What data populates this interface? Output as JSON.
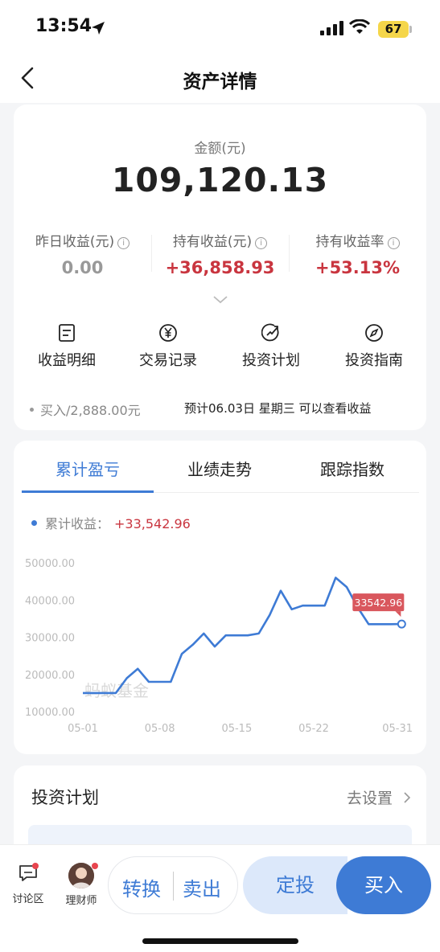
{
  "status_bar": {
    "time": "13:54",
    "battery": "67"
  },
  "nav": {
    "title": "资产详情"
  },
  "asset": {
    "amount_label": "金额(元)",
    "amount_value": "109,120.13",
    "stats": [
      {
        "label": "昨日收益(元)",
        "value": "0.00",
        "color": "#999999"
      },
      {
        "label": "持有收益(元)",
        "value": "+36,858.93",
        "color": "#c9353f"
      },
      {
        "label": "持有收益率",
        "value": "+53.13%",
        "color": "#c9353f"
      }
    ],
    "actions": [
      {
        "label": "收益明细",
        "icon": "document-icon"
      },
      {
        "label": "交易记录",
        "icon": "yen-circle-icon"
      },
      {
        "label": "投资计划",
        "icon": "trend-circle-icon"
      },
      {
        "label": "投资指南",
        "icon": "compass-icon"
      }
    ],
    "buy_note": "买入/2,888.00元",
    "expect_note": "预计06.03日 星期三 可以查看收益"
  },
  "chart_tabs": [
    {
      "label": "累计盈亏",
      "active": true
    },
    {
      "label": "业绩走势",
      "active": false
    },
    {
      "label": "跟踪指数",
      "active": false
    }
  ],
  "legend": {
    "label": "累计收益：",
    "value": "+33,542.96"
  },
  "watermark": "蚂蚁基金",
  "chart_data": {
    "type": "line",
    "series": [
      {
        "name": "累计收益",
        "points": [
          [
            1,
            15000
          ],
          [
            2,
            15000
          ],
          [
            3,
            15000
          ],
          [
            4,
            15000
          ],
          [
            5,
            19000
          ],
          [
            6,
            21500
          ],
          [
            7,
            18000
          ],
          [
            8,
            18000
          ],
          [
            9,
            18000
          ],
          [
            10,
            25500
          ],
          [
            11,
            28000
          ],
          [
            12,
            31000
          ],
          [
            13,
            27500
          ],
          [
            14,
            30500
          ],
          [
            15,
            30500
          ],
          [
            16,
            30500
          ],
          [
            17,
            31000
          ],
          [
            18,
            36000
          ],
          [
            19,
            42500
          ],
          [
            20,
            37500
          ],
          [
            21,
            38500
          ],
          [
            22,
            38500
          ],
          [
            23,
            38500
          ],
          [
            24,
            46000
          ],
          [
            25,
            43500
          ],
          [
            26,
            38000
          ],
          [
            27,
            33500
          ],
          [
            28,
            33500
          ],
          [
            29,
            33500
          ],
          [
            30,
            33542.96
          ]
        ]
      }
    ],
    "y_ticks": [
      "50000.00",
      "40000.00",
      "30000.00",
      "20000.00",
      "10000.00"
    ],
    "x_ticks": [
      "05-01",
      "05-08",
      "05-15",
      "05-22",
      "05-31"
    ],
    "ylim": [
      10000,
      50000
    ],
    "last_label": "33542.96",
    "line_color": "#3e7bd5",
    "label_color": "#d9575d"
  },
  "plan": {
    "title": "投资计划",
    "link": "去设置"
  },
  "bottom_bar": {
    "discuss": "讨论区",
    "advisor": "理财师",
    "convert": "转换",
    "sell": "卖出",
    "fixed_invest": "定投",
    "buy": "买入"
  },
  "colors": {
    "accent": "#3e7bd5",
    "gain": "#c9353f"
  }
}
